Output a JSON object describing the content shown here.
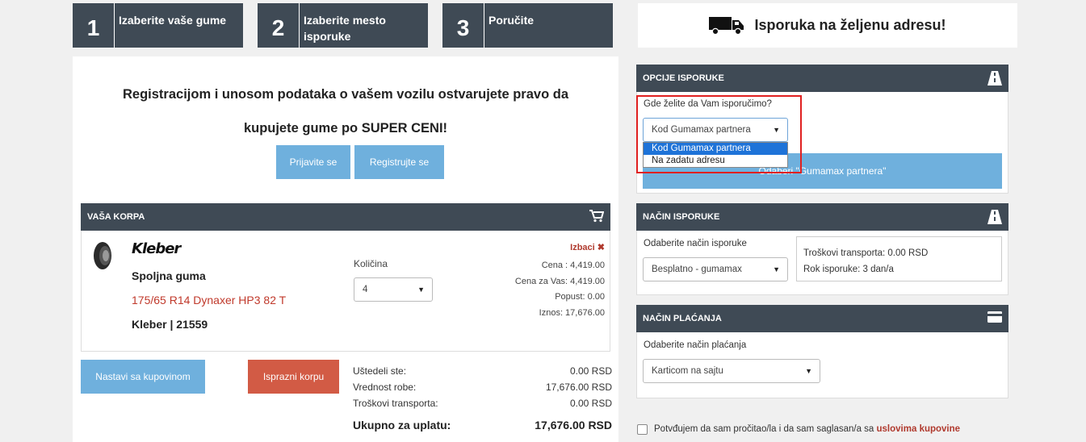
{
  "steps": [
    {
      "num": "1",
      "label": "Izaberite vaše gume"
    },
    {
      "num": "2",
      "label": "Izaberite mesto isporuke"
    },
    {
      "num": "3",
      "label": "Poručite"
    }
  ],
  "delivery_banner": {
    "text": "Isporuka na željenu adresu!",
    "icon": "truck-icon"
  },
  "promo": {
    "line1": "Registracijom i unosom podataka o vašem vozilu ostvarujete pravo da",
    "line2": "kupujete gume po SUPER CENI!"
  },
  "auth": {
    "login": "Prijavite se",
    "register": "Registrujte se"
  },
  "cart": {
    "title": "VAŠA KORPA",
    "brand": "Kleber",
    "product_type": "Spoljna guma",
    "product_name": "175/65 R14 Dynaxer HP3 82 T",
    "product_meta": "Kleber | 21559",
    "quantity_label": "Količina",
    "quantity_value": "4",
    "remove_label": "Izbaci",
    "price": "Cena : 4,419.00",
    "your_price": "Cena za Vas: 4,419.00",
    "discount": "Popust: 0.00",
    "amount": "Iznos: 17,676.00"
  },
  "actions": {
    "continue": "Nastavi sa kupovinom",
    "empty": "Isprazni korpu"
  },
  "summary": {
    "saved_label": "Uštedeli ste:",
    "saved_value": "0.00 RSD",
    "goods_label": "Vrednost robe:",
    "goods_value": "17,676.00 RSD",
    "transport_label": "Troškovi transporta:",
    "transport_value": "0.00 RSD",
    "total_label": "Ukupno za uplatu:",
    "total_value": "17,676.00 RSD"
  },
  "delivery_options": {
    "title": "OPCIJE ISPORUKE",
    "question": "Gde želite da Vam isporučimo?",
    "selected": "Kod Gumamax partnera",
    "options": [
      "Kod Gumamax partnera",
      "Na zadatu adresu"
    ],
    "choose_partner": "Odaberi \"Gumamax partnera\""
  },
  "delivery_method": {
    "title": "NAČIN ISPORUKE",
    "label": "Odaberite način isporuke",
    "selected": "Besplatno - gumamax",
    "transport_cost": "Troškovi transporta: 0.00 RSD",
    "delivery_time": "Rok isporuke: 3 dan/a"
  },
  "payment": {
    "title": "NAČIN PLAĆANJA",
    "label": "Odaberite način plaćanja",
    "selected": "Karticom na sajtu"
  },
  "terms": {
    "text": "Potvđujem da sam pročitao/la i da sam saglasan/a sa ",
    "link": "uslovima kupovine"
  },
  "colors": {
    "header": "#3f4a55",
    "button_blue": "#6fb0dd",
    "button_red": "#d25b45",
    "product_red": "#c0392b",
    "highlight": "#e02020"
  }
}
